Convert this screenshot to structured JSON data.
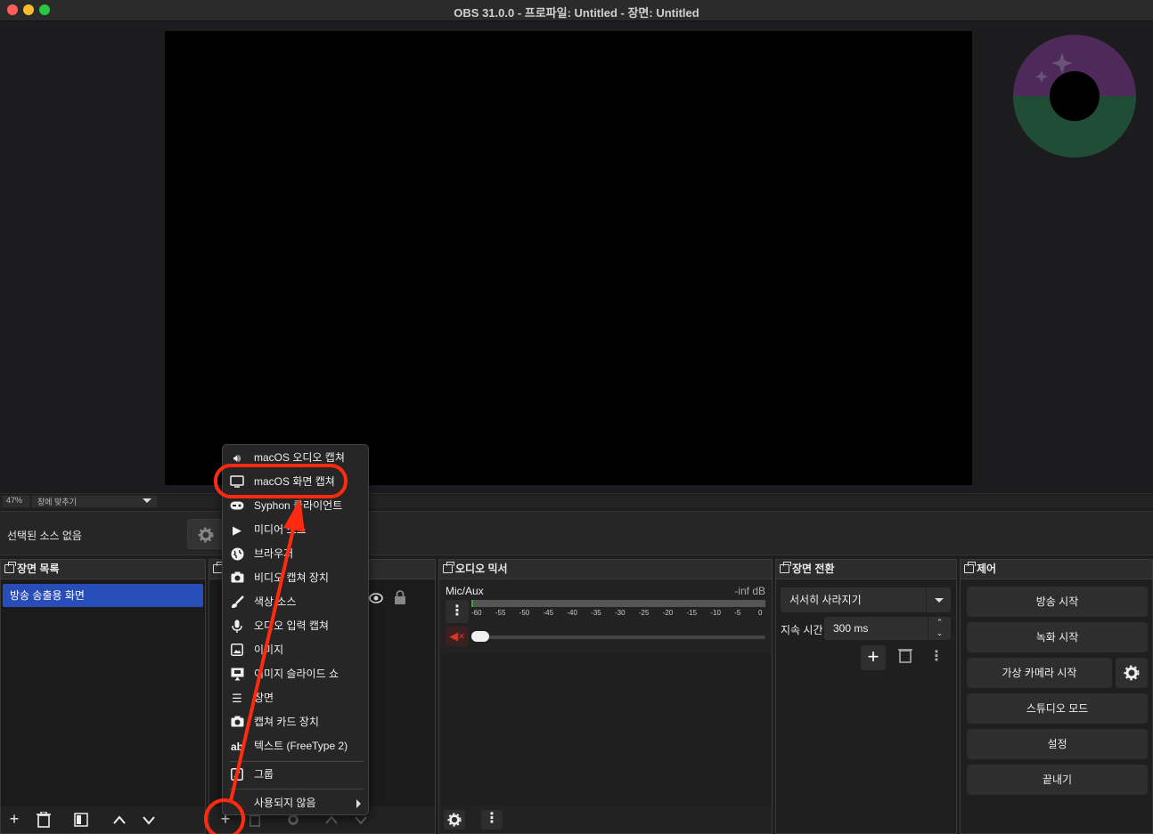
{
  "window": {
    "title": "OBS 31.0.0 - 프로파일: Untitled - 장면: Untitled"
  },
  "zoom": {
    "percent": "47%",
    "fit_label": "창에 맞추기"
  },
  "source_bar": {
    "no_source": "선택된 소스 없음"
  },
  "docks": {
    "scenes": {
      "title": "장면 목록",
      "items": [
        "방송 송출용 화면"
      ]
    },
    "sources": {
      "title": ""
    },
    "mixer": {
      "title": "오디오 믹서",
      "channel": "Mic/Aux",
      "level": "-inf dB",
      "scale": [
        "-60",
        "-55",
        "-50",
        "-45",
        "-40",
        "-35",
        "-30",
        "-25",
        "-20",
        "-15",
        "-10",
        "-5",
        "0"
      ]
    },
    "transitions": {
      "title": "장면 전환",
      "selected": "서서히 사라지기",
      "duration_label": "지속 시간",
      "duration_value": "300 ms"
    },
    "controls": {
      "title": "제어",
      "buttons": [
        "방송 시작",
        "녹화 시작",
        "가상 카메라 시작",
        "스튜디오 모드",
        "설정",
        "끝내기"
      ]
    }
  },
  "add_source_menu": {
    "items": [
      {
        "label": "macOS 오디오 캡쳐",
        "icon": "speaker-icon"
      },
      {
        "label": "macOS 화면 캡쳐",
        "icon": "monitor-icon"
      },
      {
        "label": "Syphon 클라이언트",
        "icon": "gamepad-icon"
      },
      {
        "label": "미디어 소스",
        "icon": "play-icon"
      },
      {
        "label": "브라우저",
        "icon": "globe-icon"
      },
      {
        "label": "비디오 캡쳐 장치",
        "icon": "camera-icon"
      },
      {
        "label": "색상 소스",
        "icon": "brush-icon"
      },
      {
        "label": "오디오 입력 캡쳐",
        "icon": "microphone-icon"
      },
      {
        "label": "이미지",
        "icon": "image-icon"
      },
      {
        "label": "이미지 슬라이드 쇼",
        "icon": "slideshow-icon"
      },
      {
        "label": "장면",
        "icon": "list-icon"
      },
      {
        "label": "캡쳐 카드 장치",
        "icon": "capture-card-icon"
      },
      {
        "label": "텍스트 (FreeType 2)",
        "icon": "text-icon"
      },
      {
        "label": "그룹",
        "icon": "group-icon"
      },
      {
        "label": "사용되지 않음",
        "icon": ""
      }
    ]
  },
  "colors": {
    "accent": "#284cb8",
    "annotation": "#ff2a10"
  }
}
